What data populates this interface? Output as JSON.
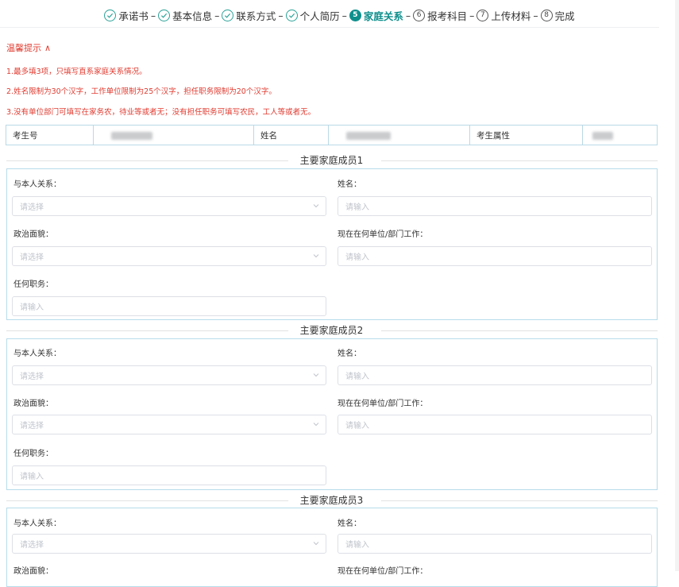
{
  "steps": [
    {
      "label": "承诺书",
      "state": "done",
      "num": ""
    },
    {
      "label": "基本信息",
      "state": "done",
      "num": ""
    },
    {
      "label": "联系方式",
      "state": "done",
      "num": ""
    },
    {
      "label": "个人简历",
      "state": "done",
      "num": ""
    },
    {
      "label": "家庭关系",
      "state": "active",
      "num": "5"
    },
    {
      "label": "报考科目",
      "state": "todo",
      "num": "6"
    },
    {
      "label": "上传材料",
      "state": "todo",
      "num": "7"
    },
    {
      "label": "完成",
      "state": "todo",
      "num": "8"
    }
  ],
  "step_separator": "–",
  "tips": {
    "title": "温馨提示",
    "caret": "∧",
    "lines": [
      "1.最多填3项，只填写直系家庭关系情况。",
      "2.姓名限制为30个汉字，工作单位限制为25个汉字，担任职务限制为20个汉字。",
      "3.没有单位部门可填写在家务农，待业等或者无；没有担任职务可填写农民，工人等或者无。"
    ]
  },
  "candidate": {
    "number_label": "考生号",
    "name_label": "姓名",
    "attr_label": "考生属性"
  },
  "members": [
    {
      "title": "主要家庭成员1",
      "relation_label": "与本人关系：",
      "relation_placeholder": "请选择",
      "name_label": "姓名：",
      "name_placeholder": "请输入",
      "politics_label": "政治面貌：",
      "politics_placeholder": "请选择",
      "work_label": "现在在何单位/部门工作：",
      "work_placeholder": "请输入",
      "duty_label": "任何职务：",
      "duty_placeholder": "请输入"
    },
    {
      "title": "主要家庭成员2",
      "relation_label": "与本人关系：",
      "relation_placeholder": "请选择",
      "name_label": "姓名：",
      "name_placeholder": "请输入",
      "politics_label": "政治面貌：",
      "politics_placeholder": "请选择",
      "work_label": "现在在何单位/部门工作：",
      "work_placeholder": "请输入",
      "duty_label": "任何职务：",
      "duty_placeholder": "请输入"
    },
    {
      "title": "主要家庭成员3",
      "relation_label": "与本人关系：",
      "relation_placeholder": "请选择",
      "name_label": "姓名：",
      "name_placeholder": "请输入",
      "politics_label": "政治面貌：",
      "work_label": "现在在何单位/部门工作："
    }
  ]
}
